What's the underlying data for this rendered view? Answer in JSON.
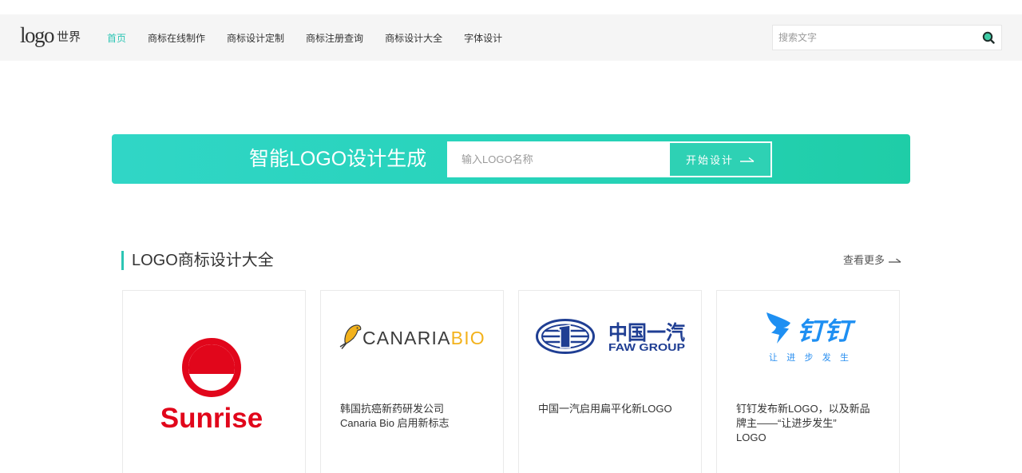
{
  "header": {
    "logo": {
      "main": "logo",
      "sub": "世界"
    },
    "nav": [
      {
        "label": "首页",
        "active": true
      },
      {
        "label": "商标在线制作",
        "active": false
      },
      {
        "label": "商标设计定制",
        "active": false
      },
      {
        "label": "商标注册查询",
        "active": false
      },
      {
        "label": "商标设计大全",
        "active": false
      },
      {
        "label": "字体设计",
        "active": false
      }
    ],
    "search": {
      "placeholder": "搜索文字",
      "value": "",
      "icon": "search-icon"
    }
  },
  "banner": {
    "title": "智能LOGO设计生成",
    "input": {
      "placeholder": "输入LOGO名称",
      "value": ""
    },
    "button": {
      "label": "开始设计",
      "icon": "arrow-right-icon"
    }
  },
  "section": {
    "title": "LOGO商标设计大全",
    "more": {
      "label": "查看更多",
      "icon": "arrow-right-icon"
    },
    "cards": [
      {
        "logo": {
          "icon": "sunrise-logo",
          "wordmark": "Sunrise"
        },
        "caption_lines": []
      },
      {
        "logo": {
          "icon": "canaria-bio-logo",
          "wordmark": "CANARIA",
          "wordmark_accent": "BIO"
        },
        "caption_lines": [
          "韩国抗癌新药研发公司",
          "Canaria Bio 启用新标志"
        ]
      },
      {
        "logo": {
          "icon": "faw-group-logo",
          "wordmark": "中国一汽",
          "wordmark_en": "FAW GROUP"
        },
        "caption_lines": [
          "中国一汽启用扁平化新LOGO"
        ]
      },
      {
        "logo": {
          "icon": "dingtalk-logo",
          "wordmark": "钉钉",
          "slogan": "让 进 步 发 生"
        },
        "caption_lines": [
          "钉钉发布新LOGO，以及新品",
          "牌主——“让进步发生”",
          "LOGO"
        ]
      }
    ]
  },
  "colors": {
    "accent": "#2cc5b4",
    "banner_gradient_start": "#30d6c6",
    "banner_gradient_end": "#1fcda7",
    "button": "#2ed1b4",
    "sunrise_red": "#e1061b",
    "canaria_yellow": "#f3b21c",
    "faw_blue": "#1f3e93",
    "dingtalk_blue": "#1e8ff2"
  }
}
